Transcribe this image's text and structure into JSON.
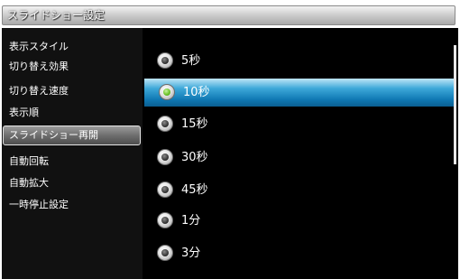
{
  "window": {
    "title": "スライドショー設定"
  },
  "sidebar": {
    "items": [
      {
        "label": "表示スタイル",
        "selected": false
      },
      {
        "label": "切り替え効果",
        "selected": false
      },
      {
        "label": "切り替え速度",
        "selected": false
      },
      {
        "label": "表示順",
        "selected": false
      },
      {
        "label": "スライドショー再開",
        "selected": true
      },
      {
        "label": "自動回転",
        "selected": false
      },
      {
        "label": "自動拡大",
        "selected": false
      },
      {
        "label": "一時停止設定",
        "selected": false
      }
    ]
  },
  "options": {
    "items": [
      {
        "label": "5秒",
        "checked": false,
        "highlighted": false
      },
      {
        "label": "10秒",
        "checked": true,
        "highlighted": true
      },
      {
        "label": "15秒",
        "checked": false,
        "highlighted": false
      },
      {
        "label": "30秒",
        "checked": false,
        "highlighted": false
      },
      {
        "label": "45秒",
        "checked": false,
        "highlighted": false
      },
      {
        "label": "1分",
        "checked": false,
        "highlighted": false
      },
      {
        "label": "3分",
        "checked": false,
        "highlighted": false
      }
    ]
  },
  "colors": {
    "highlight": "#1a8ccb",
    "checked_radio": "#6fc42c",
    "menu_background": "#111111",
    "content_background": "#000000"
  }
}
